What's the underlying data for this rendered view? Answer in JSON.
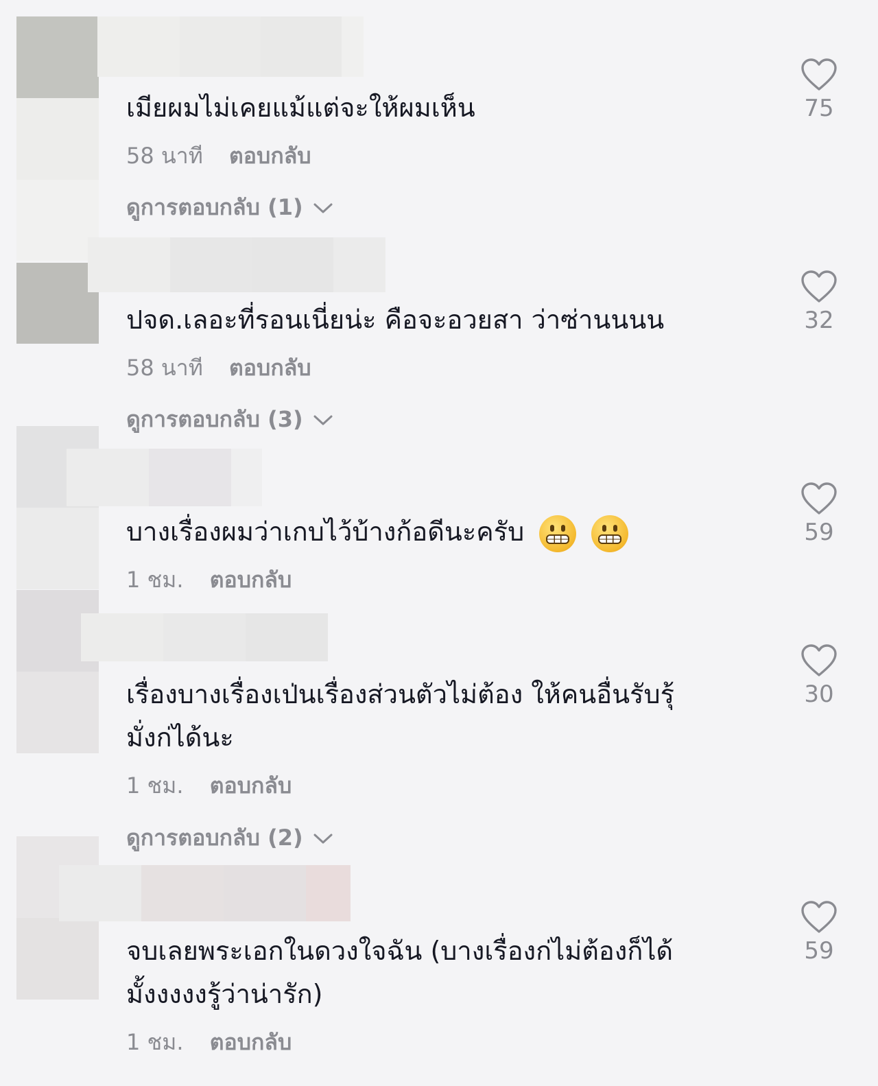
{
  "comments": [
    {
      "text_lines": [
        "เมียผมไม่เคยแม้แต่จะให้ผมเห็น"
      ],
      "time": "58 นาที",
      "reply_label": "ตอบกลับ",
      "view_replies": "ดูการตอบกลับ (1)",
      "likes": "75"
    },
    {
      "text_lines": [
        "ปจด.เลอะที่รอนเนี่ยน่ะ คือจะอวยสา ว่าซ่านนนน"
      ],
      "time": "58 นาที",
      "reply_label": "ตอบกลับ",
      "view_replies": "ดูการตอบกลับ (3)",
      "likes": "32"
    },
    {
      "text_lines": [
        "บางเรื่องผมว่าเกบไว้บ้างก้อดีนะครับ"
      ],
      "time": "1 ชม.",
      "reply_label": "ตอบกลับ",
      "likes": "59",
      "emoji_icons": [
        "grimacing-face-icon",
        "grimacing-face-icon"
      ]
    },
    {
      "text_lines": [
        "เรื่องบางเรื่องเป่นเรื่องส่วนตัวไม่ต้อง ให้คนอื่นรับรุ้",
        "มั่งก่ได้นะ"
      ],
      "time": "1 ชม.",
      "reply_label": "ตอบกลับ",
      "view_replies": "ดูการตอบกลับ (2)",
      "likes": "30"
    },
    {
      "text_lines": [
        "จบเลยพระเอกในดวงใจฉัน (บางเรื่องก่ไม่ต้องก็ได้",
        "มั้งงงงงรู้ว่าน่ารัก)"
      ],
      "time": "1 ชม.",
      "reply_label": "ตอบกลับ",
      "likes": "59"
    }
  ],
  "icons": {
    "like": "heart-outline-icon",
    "expand": "chevron-down-icon",
    "avatar": "blurred-avatar",
    "username": "blurred-username"
  },
  "colors": {
    "background": "#f4f4f6",
    "text": "#161823",
    "secondary": "#8a8b91"
  }
}
